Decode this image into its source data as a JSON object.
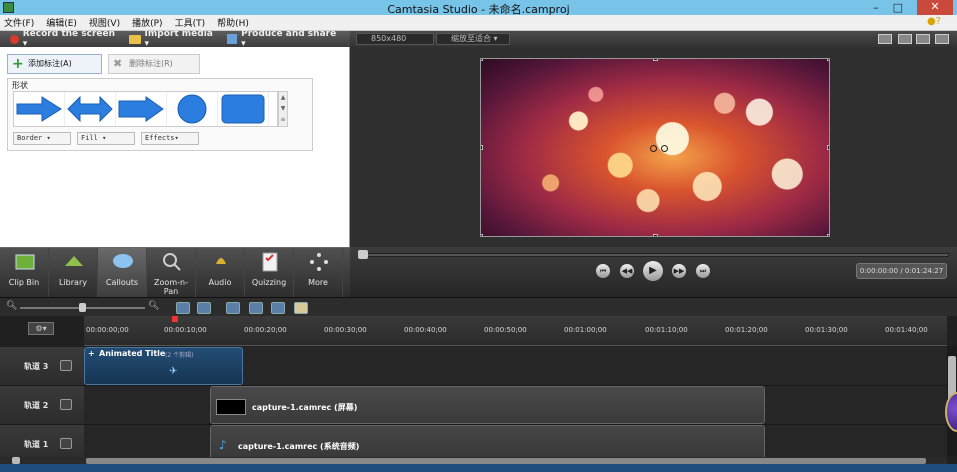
{
  "window": {
    "title": "Camtasia Studio - 未命名.camproj",
    "controls": [
      "–",
      "□",
      "✕"
    ]
  },
  "menu": [
    "文件(F)",
    "编辑(E)",
    "视图(V)",
    "播放(P)",
    "工具(T)",
    "帮助(H)"
  ],
  "toolbar": {
    "record": "Record the screen ▾",
    "import": "Import media ▾",
    "produce": "Produce and share ▾"
  },
  "preview_toolbar": {
    "dimensions": "850x480",
    "zoom": "缩放至适合 ▾"
  },
  "callouts": {
    "add_label": "添加标注(A)",
    "delete_label": "删除标注(R)",
    "shapes_label": "形状",
    "border": "Border ▾",
    "fill": "Fill ▾",
    "effects": "Effects▾"
  },
  "tabs": [
    {
      "label": "Clip Bin",
      "icon": "clip-bin-icon"
    },
    {
      "label": "Library",
      "icon": "library-icon"
    },
    {
      "label": "Callouts",
      "icon": "callouts-icon"
    },
    {
      "label": "Zoom-n-Pan",
      "icon": "zoom-icon"
    },
    {
      "label": "Audio",
      "icon": "audio-icon"
    },
    {
      "label": "Quizzing",
      "icon": "quizzing-icon"
    },
    {
      "label": "More",
      "icon": "more-icon"
    }
  ],
  "playback": {
    "time": "0:00:00:00 / 0:01:24:27"
  },
  "ruler": [
    "00:00:00;00",
    "00:00:10;00",
    "00:00:20;00",
    "00:00:30;00",
    "00:00:40;00",
    "00:00:50;00",
    "00:01:00;00",
    "00:01:10;00",
    "00:01:20;00",
    "00:01:30;00",
    "00:01:40;00"
  ],
  "tracks": [
    {
      "name": "轨道 3"
    },
    {
      "name": "轨道 2"
    },
    {
      "name": "轨道 1"
    }
  ],
  "clips": {
    "title_clip": "Animated Title",
    "title_sub": "(2 个剪辑)",
    "video_clip": "capture-1.camrec (屏幕)",
    "audio_clip": "capture-1.camrec (系统音频)"
  },
  "colors": {
    "accent": "#78c4e8",
    "title_clip": "#234d75",
    "playhead": "#e33333"
  }
}
